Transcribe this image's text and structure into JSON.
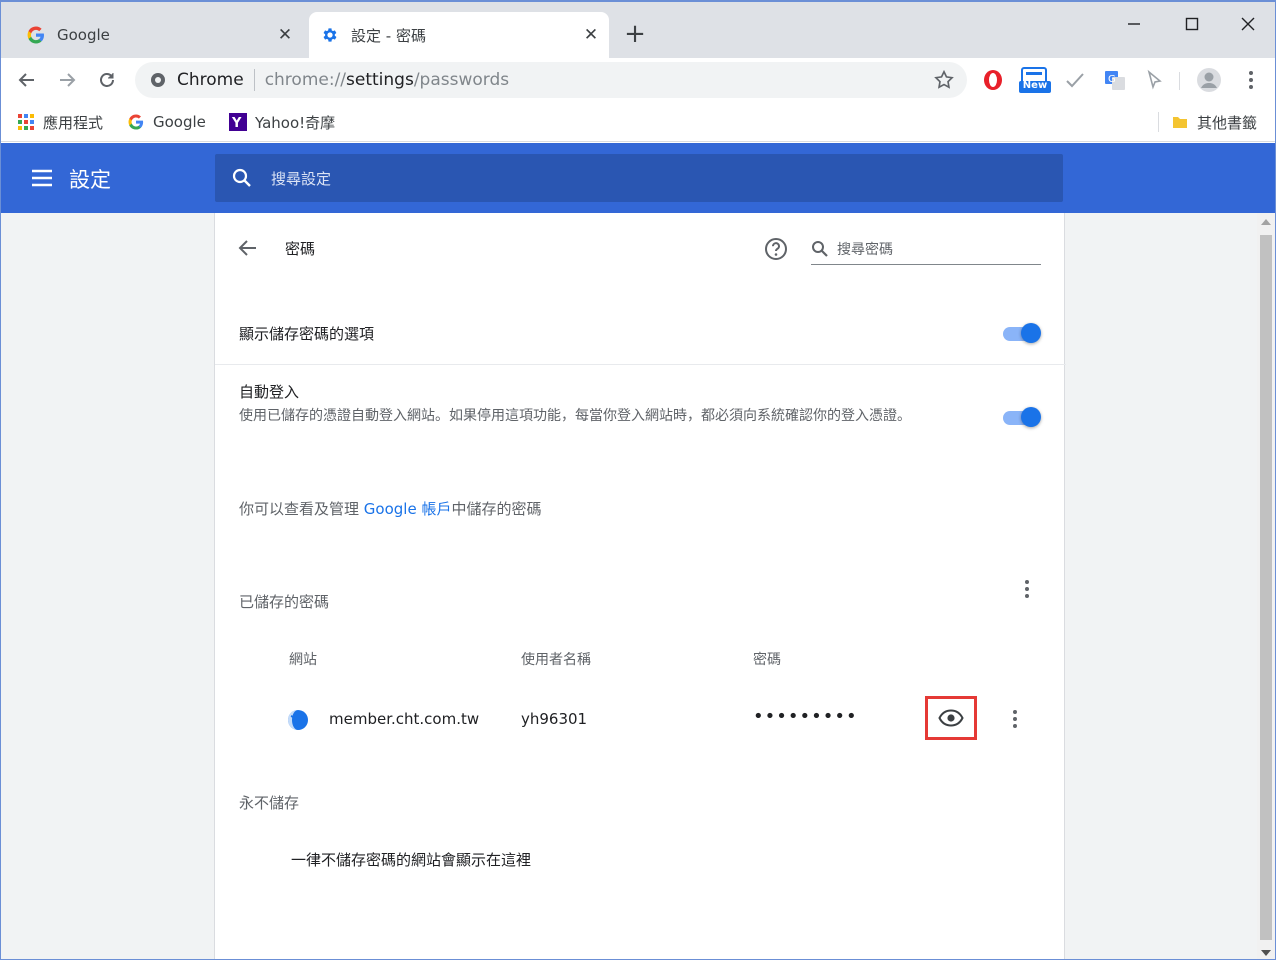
{
  "tabs": [
    {
      "title": "Google",
      "active": false
    },
    {
      "title": "設定 - 密碼",
      "active": true
    }
  ],
  "toolbar": {
    "omnibox_chip": "Chrome",
    "url_scheme": "chrome://",
    "url_host": "settings",
    "url_path": "/passwords",
    "new_badge": "New"
  },
  "bookmarks": [
    {
      "label": "應用程式",
      "icon": "apps-grid-icon"
    },
    {
      "label": "Google",
      "icon": "google-icon"
    },
    {
      "label": "Yahoo!奇摩",
      "icon": "yahoo-icon"
    }
  ],
  "other_bookmarks": "其他書籤",
  "settings": {
    "title": "設定",
    "search_placeholder": "搜尋設定"
  },
  "passwords": {
    "title": "密碼",
    "search_placeholder": "搜尋密碼",
    "offer_save_label": "顯示儲存密碼的選項",
    "offer_save_enabled": true,
    "auto_signin_label": "自動登入",
    "auto_signin_desc": "使用已儲存的憑證自動登入網站。如果停用這項功能，每當你登入網站時，都必須向系統確認你的登入憑證。",
    "auto_signin_enabled": true,
    "account_text_before": "你可以查看及管理 ",
    "account_link": "Google 帳戶",
    "account_text_after": "中儲存的密碼",
    "saved_section": "已儲存的密碼",
    "columns": {
      "site": "網站",
      "username": "使用者名稱",
      "password": "密碼"
    },
    "entries": [
      {
        "site": "member.cht.com.tw",
        "username": "yh96301",
        "password_masked": "•••••••••"
      }
    ],
    "never_section": "永不儲存",
    "never_empty": "一律不儲存密碼的網站會顯示在這裡"
  },
  "colors": {
    "accent": "#3367d6",
    "link": "#1a73e8",
    "highlight_box": "#e53935"
  }
}
